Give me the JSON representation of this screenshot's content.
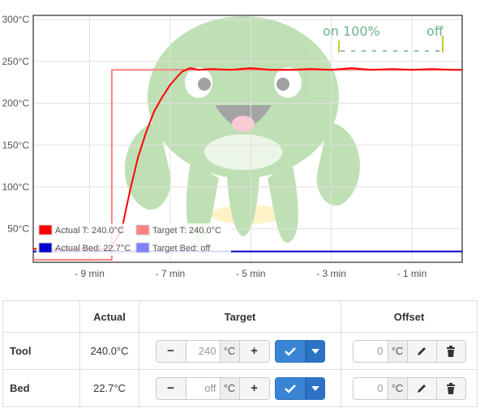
{
  "chart_data": {
    "type": "line",
    "y_ticks": [
      "300°C",
      "250°C",
      "200°C",
      "150°C",
      "100°C",
      "50°C"
    ],
    "x_ticks": [
      "- 9 min",
      "- 7 min",
      "- 5 min",
      "- 3 min",
      "- 1 min"
    ],
    "ylim": [
      10,
      305
    ],
    "xlim": [
      -10.4,
      0.25
    ],
    "grid": true,
    "legend_position": "bottom-left",
    "series": [
      {
        "name": "Actual T: 240.0°C",
        "color": "#ff0000",
        "x": [
          -10.4,
          -8.6,
          -8.45,
          -8.2,
          -8.0,
          -7.8,
          -7.6,
          -7.4,
          -7.2,
          -7.0,
          -6.8,
          -6.7,
          -6.6,
          -6.5,
          -6.3,
          -6.0,
          -5.5,
          -5.0,
          -4.5,
          -4.0,
          -3.5,
          -3.0,
          -2.5,
          -2.0,
          -1.5,
          -1.0,
          -0.5,
          0.0,
          0.25
        ],
        "y": [
          26,
          26,
          28,
          50,
          95,
          135,
          165,
          190,
          207,
          222,
          233,
          238,
          240,
          242,
          240,
          241,
          240,
          242,
          240,
          240,
          241,
          240,
          242,
          240,
          241,
          240,
          241,
          240,
          240
        ]
      },
      {
        "name": "Target T: 240.0°C",
        "color": "#ff8080",
        "x": [
          -10.4,
          -8.45,
          -8.45,
          0.25
        ],
        "y": [
          13,
          13,
          240,
          240
        ]
      },
      {
        "name": "Actual Bed: 22.7°C",
        "color": "#0000cc",
        "x": [
          -10.4,
          -6.0,
          -3.0,
          0.25
        ],
        "y": [
          23,
          23,
          23,
          23
        ]
      },
      {
        "name": "Target Bed: off",
        "color": "#8080ff",
        "x": [],
        "y": []
      }
    ],
    "annotations": [
      "on 100%",
      "off"
    ]
  },
  "table": {
    "headers": {
      "actual": "Actual",
      "target": "Target",
      "offset": "Offset"
    },
    "rows": [
      {
        "label": "Tool",
        "actual": "240.0°C",
        "target_value": "240",
        "target_placeholder": "",
        "unit": "°C",
        "offset_value": "0",
        "offset_unit": "°C"
      },
      {
        "label": "Bed",
        "actual": "22.7°C",
        "target_value": "off",
        "target_placeholder": "off",
        "unit": "°C",
        "offset_value": "0",
        "offset_unit": "°C"
      }
    ],
    "buttons": {
      "minus": "−",
      "plus": "+"
    }
  },
  "icons": {
    "set": "check-icon",
    "dropdown": "caret-down-icon",
    "edit": "pencil-icon",
    "delete": "trash-icon"
  },
  "colors": {
    "primary": "#3a84d6",
    "actual_tool": "#ff0000",
    "target_tool": "#ff8080",
    "actual_bed": "#0000cc",
    "target_bed": "#8080ff",
    "mascot": "#8cc87a"
  }
}
